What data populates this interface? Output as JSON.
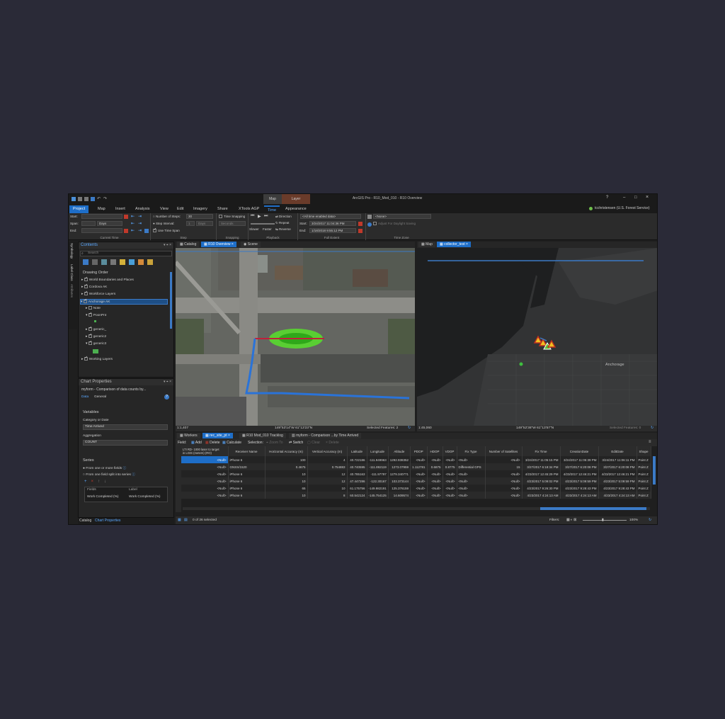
{
  "window": {
    "title": "ArcGIS Pro - R10_Mod_010 - R10 Overview",
    "user": "tcchristensen (U.S. Forest Service)",
    "help": "?",
    "context_tab_map": "Map",
    "context_tab_layer": "Layer"
  },
  "ribbon_tabs": [
    "Project",
    "Map",
    "Insert",
    "Analysis",
    "View",
    "Edit",
    "Imagery",
    "Share",
    "XTools AGP",
    "Time",
    "Appearance"
  ],
  "ribbon": {
    "current_time": {
      "start_label": "Start:",
      "span_label": "Span:",
      "end_label": "End:",
      "span_unit": "Days",
      "group_label": "Current Time"
    },
    "step": {
      "number_of_steps": "Number of Steps:",
      "steps_value": "30",
      "step_interval": "Step Interval:",
      "interval_value": "1",
      "interval_unit": "Days",
      "use_time_span": "Use Time Span",
      "group_label": "Step"
    },
    "snapping": {
      "time_snapping": "Time Snapping",
      "unit": "Seconds",
      "group_label": "Snapping"
    },
    "playback": {
      "slower": "Slower",
      "faster": "Faster",
      "direction": "Direction",
      "repeat": "Repeat",
      "reverse": "Reverse",
      "group_label": "Playback"
    },
    "full_extent": {
      "option": "<All time enabled data>",
      "start_label": "Start:",
      "start_value": "3/24/2017 11:04:36 PM",
      "end_label": "End:",
      "end_value": "1/18/2018 9:55:12 PM",
      "group_label": "Full Extent"
    },
    "time_zone": {
      "value": "<None>",
      "daylight": "Adjust For Daylight Saving",
      "group_label": "Time Zone"
    }
  },
  "contents": {
    "title": "Contents",
    "search_placeholder": "Search",
    "drawing_order": "Drawing Order",
    "layers": [
      "World Boundaries and Places",
      "Cordova AK",
      "Workforce Layers",
      "Anchorage AK",
      "Note",
      "PoonPnt",
      "generic_",
      "generic2",
      "generic3",
      "Working Layers"
    ]
  },
  "side_tabs": [
    "Symbology",
    "Label Class",
    "Attributes"
  ],
  "chart_props": {
    "title": "Chart Properties",
    "chart_name": "myform - Comparison of data counts by...",
    "tab_data": "Data",
    "tab_general": "General",
    "variables": "Variables",
    "category_label": "Category or Date",
    "category_value": "Time Arrived",
    "aggregation_label": "Aggregation",
    "aggregation_value": "COUNT",
    "series": "Series",
    "series_opt1": "From one or more fields",
    "series_opt2": "From one field split into series",
    "col_fields": "Fields",
    "col_label": "Label",
    "field_value": "Work Completed (%)",
    "label_value": "Work Completed (%)",
    "bottom_tab1": "Catalog",
    "bottom_tab2": "Chart Properties"
  },
  "views": {
    "left_tabs": [
      "Catalog",
      "R10 Overview",
      "Scene"
    ],
    "right_tabs": [
      "Map",
      "collector_test"
    ],
    "left_scale": "1:1,407",
    "left_coords": "149°53'14\"W 61°13'23\"N",
    "left_selected": "Selected Features: 2",
    "right_scale": "1:45,060",
    "right_coords": "149°52'36\"W 61°13'57\"N",
    "right_selected": "Selected Features: 0",
    "map_label": "Anchorage"
  },
  "table": {
    "tabs": [
      "Workers",
      "rec_site_pt",
      "R10 Mod_010 Tracklog",
      "myform - Comparison ...by Time Arrived"
    ],
    "toolbar": [
      "Field:",
      "Add",
      "Delete",
      "Calculate",
      "Selection:",
      "Zoom To",
      "Switch",
      "Clear",
      "Delete"
    ],
    "row_header1": "LTI RD- 1000 laser to target",
    "row_header2": "in LGIS (meters) (RO)",
    "columns": [
      "Receiver Name",
      "Horizontal Accuracy (m)",
      "Vertical Accuracy (m)",
      "Latitude",
      "Longitude",
      "Altitude",
      "PDOP",
      "HDOP",
      "VDOP",
      "Fix Type",
      "Number of Satellites",
      "Fix Time",
      "CreationDate",
      "EditDate",
      "Shape"
    ],
    "rows": [
      [
        "<Null>",
        "iPhone 6",
        "100",
        "4",
        "40.722186",
        "-111.949963",
        "1292.938352",
        "<Null>",
        "<Null>",
        "<Null>",
        "<Null>",
        "<Null>",
        "3/24/2017 11:05:15 PM",
        "3/24/2017 11:05:39 PM",
        "3/24/2017 11:06:11 PM",
        "Point Z"
      ],
      [
        "<Null>",
        "GNSS/1520",
        "0.4675",
        "0.754883",
        "40.740595",
        "-111.892119",
        "1273.07959",
        "1.112781",
        "0.6875",
        "0.8775",
        "Differential GPS",
        "15",
        "3/27/2017 6:18:34 PM",
        "3/27/2017 6:20:08 PM",
        "3/27/2017 6:20:08 PM",
        "Point Z"
      ],
      [
        "<Null>",
        "iPhone 6",
        "10",
        "12",
        "40.785163",
        "-111.97797",
        "1279.340771",
        "<Null>",
        "<Null>",
        "<Null>",
        "<Null>",
        "<Null>",
        "4/23/2017 12:45:29 PM",
        "4/23/2017 12:46:21 PM",
        "4/23/2017 12:46:21 PM",
        "Point Z"
      ],
      [
        "<Null>",
        "iPhone 6",
        "10",
        "12",
        "47.447286",
        "-122.30167",
        "103.373144",
        "<Null>",
        "<Null>",
        "<Null>",
        "<Null>",
        "<Null>",
        "4/23/2017 5:09:02 PM",
        "4/23/2017 5:09:59 PM",
        "4/23/2017 5:09:59 PM",
        "Point Z"
      ],
      [
        "<Null>",
        "iPhone 6",
        "65",
        "10",
        "61.175756",
        "-149.982191",
        "125.376159",
        "<Null>",
        "<Null>",
        "<Null>",
        "<Null>",
        "<Null>",
        "4/23/2017 9:26:30 PM",
        "4/23/2017 9:28:43 PM",
        "4/23/2017 9:28:43 PM",
        "Point Z"
      ],
      [
        "<Null>",
        "iPhone 6",
        "10",
        "8",
        "60.542124",
        "-145.754125",
        "14.609574",
        "<Null>",
        "<Null>",
        "<Null>",
        "<Null>",
        "<Null>",
        "4/23/2017 4:24:13 AM",
        "4/23/2017 4:24:13 AM",
        "4/23/2017 4:24:13 AM",
        "Point Z"
      ]
    ],
    "selected_text": "0 of 26 selected",
    "filters": "Filters:",
    "zoom": "100%"
  },
  "colors": {
    "accent": "#1e6ec8",
    "bg": "#2a2a37"
  }
}
